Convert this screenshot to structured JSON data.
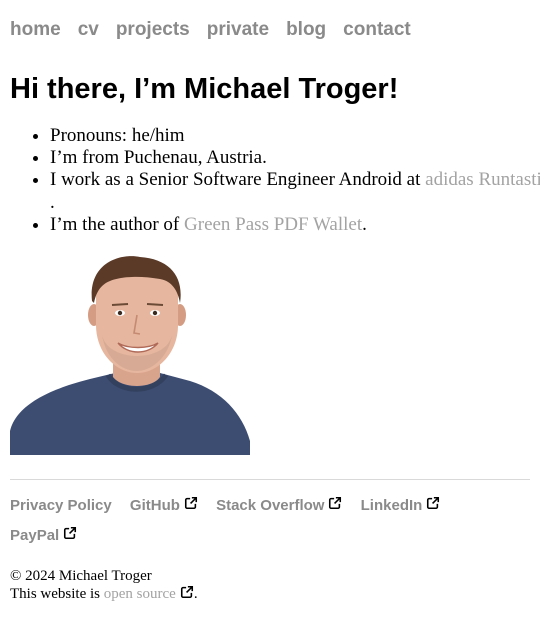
{
  "nav": {
    "items": [
      "home",
      "cv",
      "projects",
      "private",
      "blog",
      "contact"
    ]
  },
  "heading": "Hi there, I’m Michael Troger!",
  "facts": {
    "pronouns": "Pronouns: he/him",
    "from": "I’m from Puchenau, Austria.",
    "work_prefix": "I work as a Senior Software Engineer Android at ",
    "work_link": "adidas Runtastic",
    "work_suffix": ".",
    "author_prefix": "I’m the author of ",
    "author_link": "Green Pass PDF Wallet",
    "author_suffix": "."
  },
  "footer": {
    "links": [
      "Privacy Policy",
      "GitHub",
      "Stack Overflow",
      "LinkedIn",
      "PayPal"
    ],
    "copyright": "© 2024 Michael Troger",
    "open_source_prefix": "This website is ",
    "open_source_link": "open source",
    "open_source_suffix": "."
  },
  "colors": {
    "nav_link": "#8a8a8a",
    "inline_link": "#a3a3a3",
    "shirt": "#3d4d72"
  },
  "icons": {
    "external_link": "external-link-icon"
  }
}
